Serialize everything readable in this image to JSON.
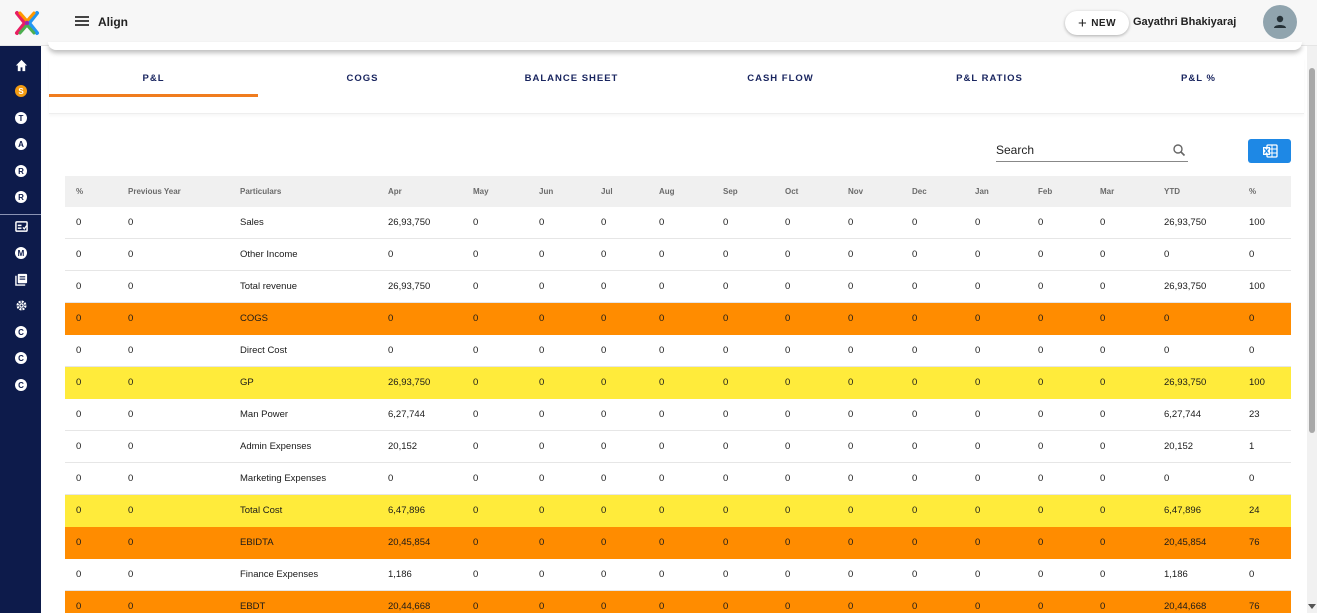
{
  "header": {
    "app_title": "Align",
    "new_button_label": "NEW",
    "user_name": "Gayathri Bhakiyaraj",
    "logo_icon": "colorful-x-logo",
    "menu_icon": "hamburger-icon",
    "avatar_icon": "person-icon"
  },
  "sidebar": {
    "items": [
      {
        "type": "icon",
        "icon": "home-icon"
      },
      {
        "type": "letter",
        "letter": "S",
        "active": true
      },
      {
        "type": "letter",
        "letter": "T"
      },
      {
        "type": "letter",
        "letter": "A"
      },
      {
        "type": "letter",
        "letter": "R"
      },
      {
        "type": "letter",
        "letter": "R"
      },
      {
        "type": "icon",
        "icon": "dashboard-icon"
      },
      {
        "type": "letter",
        "letter": "M"
      },
      {
        "type": "icon",
        "icon": "library-books-icon"
      },
      {
        "type": "icon",
        "icon": "settings-icon"
      },
      {
        "type": "letter",
        "letter": "C"
      },
      {
        "type": "letter",
        "letter": "C"
      },
      {
        "type": "letter",
        "letter": "C"
      }
    ]
  },
  "tabs": [
    {
      "label": "P&L",
      "active": true
    },
    {
      "label": "COGS"
    },
    {
      "label": "BALANCE SHEET"
    },
    {
      "label": "CASH FLOW"
    },
    {
      "label": "P&L RATIOS"
    },
    {
      "label": "P&L %"
    }
  ],
  "search": {
    "placeholder": "Search"
  },
  "colors": {
    "accent_orange": "#f07c1e",
    "row_orange": "#ff8c00",
    "row_yellow": "#ffeb3b",
    "sidebar_navy": "#0d1b4b",
    "export_blue": "#1e88e5"
  },
  "table": {
    "columns": [
      "%",
      "Previous Year",
      "Particulars",
      "Apr",
      "May",
      "Jun",
      "Jul",
      "Aug",
      "Sep",
      "Oct",
      "Nov",
      "Dec",
      "Jan",
      "Feb",
      "Mar",
      "YTD",
      "%"
    ],
    "rows": [
      {
        "highlight": "none",
        "cells": [
          "0",
          "0",
          "Sales",
          "26,93,750",
          "0",
          "0",
          "0",
          "0",
          "0",
          "0",
          "0",
          "0",
          "0",
          "0",
          "0",
          "26,93,750",
          "100"
        ]
      },
      {
        "highlight": "none",
        "cells": [
          "0",
          "0",
          "Other Income",
          "0",
          "0",
          "0",
          "0",
          "0",
          "0",
          "0",
          "0",
          "0",
          "0",
          "0",
          "0",
          "0",
          "0"
        ]
      },
      {
        "highlight": "none",
        "cells": [
          "0",
          "0",
          "Total revenue",
          "26,93,750",
          "0",
          "0",
          "0",
          "0",
          "0",
          "0",
          "0",
          "0",
          "0",
          "0",
          "0",
          "26,93,750",
          "100"
        ]
      },
      {
        "highlight": "orange",
        "cells": [
          "0",
          "0",
          "COGS",
          "0",
          "0",
          "0",
          "0",
          "0",
          "0",
          "0",
          "0",
          "0",
          "0",
          "0",
          "0",
          "0",
          "0"
        ]
      },
      {
        "highlight": "none",
        "cells": [
          "0",
          "0",
          "Direct Cost",
          "0",
          "0",
          "0",
          "0",
          "0",
          "0",
          "0",
          "0",
          "0",
          "0",
          "0",
          "0",
          "0",
          "0"
        ]
      },
      {
        "highlight": "yellow",
        "cells": [
          "0",
          "0",
          "GP",
          "26,93,750",
          "0",
          "0",
          "0",
          "0",
          "0",
          "0",
          "0",
          "0",
          "0",
          "0",
          "0",
          "26,93,750",
          "100"
        ]
      },
      {
        "highlight": "none",
        "cells": [
          "0",
          "0",
          "Man Power",
          "6,27,744",
          "0",
          "0",
          "0",
          "0",
          "0",
          "0",
          "0",
          "0",
          "0",
          "0",
          "0",
          "6,27,744",
          "23"
        ]
      },
      {
        "highlight": "none",
        "cells": [
          "0",
          "0",
          "Admin Expenses",
          "20,152",
          "0",
          "0",
          "0",
          "0",
          "0",
          "0",
          "0",
          "0",
          "0",
          "0",
          "0",
          "20,152",
          "1"
        ]
      },
      {
        "highlight": "none",
        "cells": [
          "0",
          "0",
          "Marketing Expenses",
          "0",
          "0",
          "0",
          "0",
          "0",
          "0",
          "0",
          "0",
          "0",
          "0",
          "0",
          "0",
          "0",
          "0"
        ]
      },
      {
        "highlight": "yellow",
        "cells": [
          "0",
          "0",
          "Total Cost",
          "6,47,896",
          "0",
          "0",
          "0",
          "0",
          "0",
          "0",
          "0",
          "0",
          "0",
          "0",
          "0",
          "6,47,896",
          "24"
        ]
      },
      {
        "highlight": "orange",
        "cells": [
          "0",
          "0",
          "EBIDTA",
          "20,45,854",
          "0",
          "0",
          "0",
          "0",
          "0",
          "0",
          "0",
          "0",
          "0",
          "0",
          "0",
          "20,45,854",
          "76"
        ]
      },
      {
        "highlight": "none",
        "cells": [
          "0",
          "0",
          "Finance Expenses",
          "1,186",
          "0",
          "0",
          "0",
          "0",
          "0",
          "0",
          "0",
          "0",
          "0",
          "0",
          "0",
          "1,186",
          "0"
        ]
      },
      {
        "highlight": "orange",
        "cells": [
          "0",
          "0",
          "EBDT",
          "20,44,668",
          "0",
          "0",
          "0",
          "0",
          "0",
          "0",
          "0",
          "0",
          "0",
          "0",
          "0",
          "20,44,668",
          "76"
        ]
      }
    ]
  }
}
